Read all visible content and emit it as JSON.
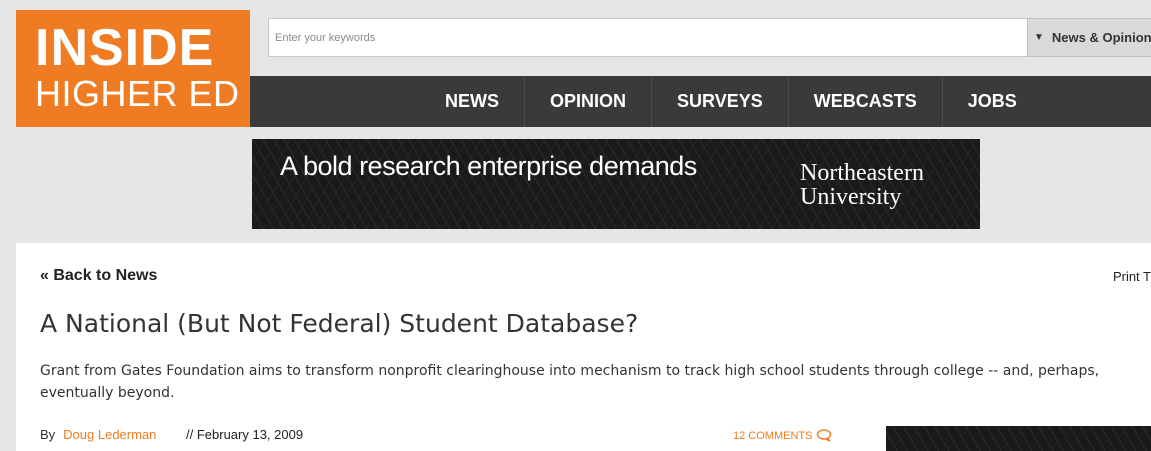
{
  "logo": {
    "line1": "INSIDE",
    "line2": "HIGHER ED"
  },
  "search": {
    "placeholder": "Enter your keywords",
    "scope": "News & Opinion"
  },
  "nav": {
    "items": [
      "NEWS",
      "OPINION",
      "SURVEYS",
      "WEBCASTS",
      "JOBS"
    ]
  },
  "banner": {
    "tagline": "A bold research enterprise demands",
    "university_line1": "Northeastern",
    "university_line2": "University"
  },
  "article": {
    "back_link": "« Back to News",
    "print": "Print T",
    "title": "A National (But Not Federal) Student Database?",
    "summary": "Grant from Gates Foundation aims to transform nonprofit clearinghouse into mechanism to track high school students through college -- and, perhaps, eventually beyond.",
    "by_label": "By",
    "author": "Doug Lederman",
    "date": "// February 13, 2009",
    "comments": "12 COMMENTS"
  },
  "colors": {
    "brand_orange": "#ef7b22",
    "nav_bg": "#3a3a3a",
    "page_bg": "#e6e6e6"
  }
}
